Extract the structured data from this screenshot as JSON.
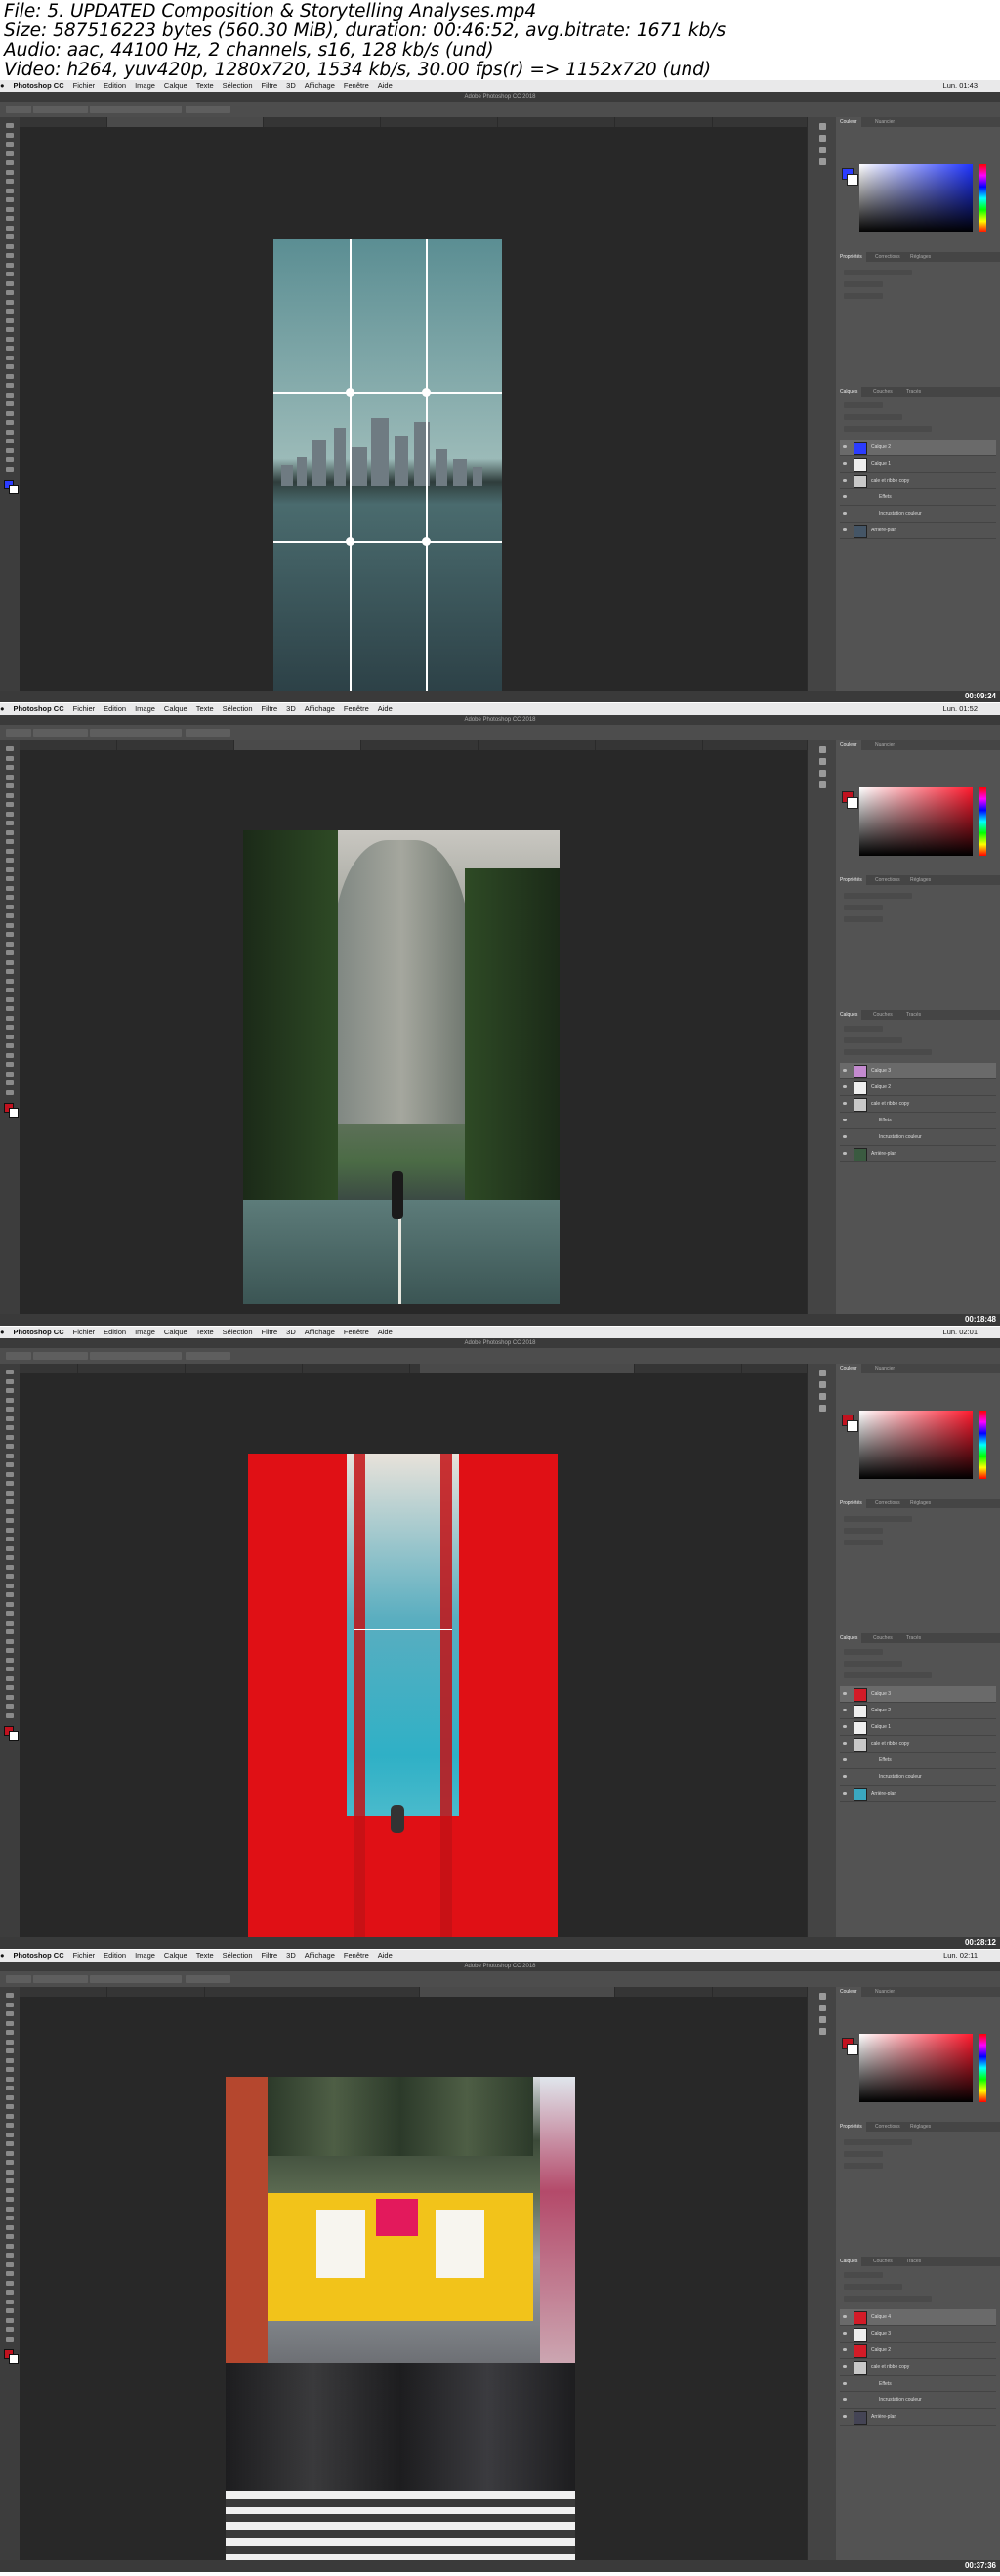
{
  "header": {
    "line1": "File: 5. UPDATED Composition & Storytelling Analyses.mp4",
    "line2": "Size: 587516223 bytes (560.30 MiB), duration: 00:46:52, avg.bitrate: 1671 kb/s",
    "line3": "Audio: aac, 44100 Hz, 2 channels, s16, 128 kb/s (und)",
    "line4": "Video: h264, yuv420p, 1280x720, 1534 kb/s, 30.00 fps(r) => 1152x720 (und)"
  },
  "menu": {
    "app": "Photoshop CC",
    "items": [
      "Fichier",
      "Edition",
      "Image",
      "Calque",
      "Texte",
      "Sélection",
      "Filtre",
      "3D",
      "Affichage",
      "Fenêtre",
      "Aide"
    ]
  },
  "window_title": "Adobe Photoshop CC 2018",
  "panels": {
    "color_tabs": [
      "Couleur",
      "Nuancier"
    ],
    "props_tabs": [
      "Propriétés",
      "Corrections",
      "Réglages"
    ],
    "layer_tabs": [
      "Calques",
      "Couches",
      "Tracés"
    ]
  },
  "frames": [
    {
      "clock": "Lun. 01:43",
      "timestamp": "00:09:24",
      "accent": "#2b3cff",
      "layers": [
        "Calque 2",
        "Calque 1",
        "cale et ribbe copy",
        "Effets",
        "Incrustation couleur",
        "Arrière-plan"
      ]
    },
    {
      "clock": "Lun. 01:52",
      "timestamp": "00:18:48",
      "accent": "#c1121f",
      "layers": [
        "Calque 3",
        "Calque 2",
        "cale et ribbe copy",
        "Effets",
        "Incrustation couleur",
        "Arrière-plan"
      ]
    },
    {
      "clock": "Lun. 02:01",
      "timestamp": "00:28:12",
      "accent": "#c1121f",
      "layers": [
        "Calque 3",
        "Calque 2",
        "Calque 1",
        "cale et ribbe copy",
        "Effets",
        "Incrustation couleur",
        "Arrière-plan"
      ]
    },
    {
      "clock": "Lun. 02:11",
      "timestamp": "00:37:36",
      "accent": "#c1121f",
      "layers": [
        "Calque 4",
        "Calque 3",
        "Calque 2",
        "cale et ribbe copy",
        "Effets",
        "Incrustation couleur",
        "Arrière-plan"
      ]
    }
  ]
}
